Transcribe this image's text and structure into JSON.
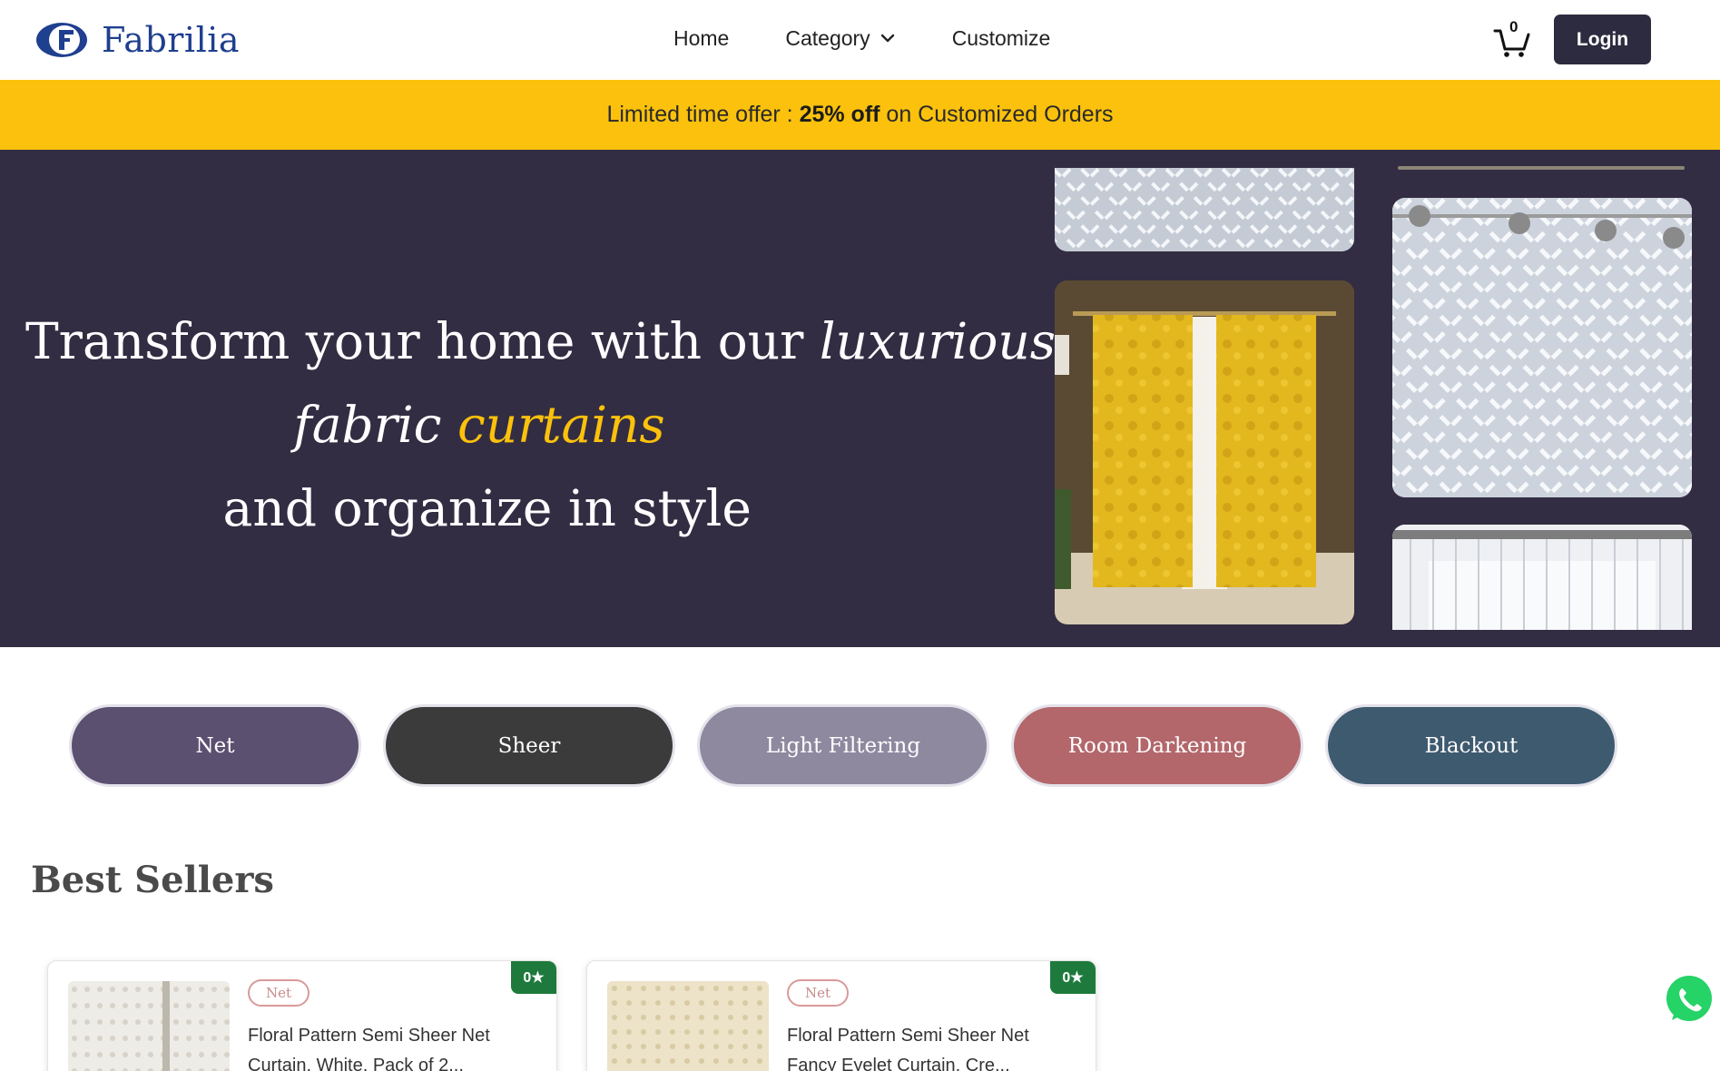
{
  "brand": {
    "name": "Fabrilia"
  },
  "nav": {
    "home": "Home",
    "category": "Category",
    "customize": "Customize",
    "cart_count": "0",
    "login": "Login"
  },
  "offer": {
    "prefix": "Limited time offer : ",
    "highlight": "25% off",
    "suffix": " on Customized Orders"
  },
  "hero": {
    "line1_plain": "Transform your home with our ",
    "line1_italic": "luxurious",
    "line2_italic": "fabric",
    "line2_accent": "curtains",
    "line2_plain": " and organize in style"
  },
  "categories": [
    {
      "label": "Net",
      "color": "#5b5070"
    },
    {
      "label": "Sheer",
      "color": "#3b3b3b"
    },
    {
      "label": "Light Filtering",
      "color": "#8e899f"
    },
    {
      "label": "Room Darkening",
      "color": "#b3676b"
    },
    {
      "label": "Blackout",
      "color": "#3e5a6f"
    }
  ],
  "best_sellers": {
    "title": "Best Sellers",
    "items": [
      {
        "tag": "Net",
        "title": "Floral Pattern Semi Sheer Net Curtain, White, Pack of 2...",
        "rating": "0★"
      },
      {
        "tag": "Net",
        "title": "Floral Pattern Semi Sheer Net Fancy Eyelet Curtain, Cre...",
        "rating": "0★"
      }
    ]
  },
  "colors": {
    "accent_yellow": "#fbc10c",
    "hero_bg": "#332d43",
    "brand_blue": "#1f3f8f",
    "login_bg": "#2d2b3f",
    "rating_green": "#1e7a3c",
    "whatsapp_green": "#25d366"
  },
  "icons": [
    "brand-logo-icon",
    "chevron-down-icon",
    "cart-icon",
    "whatsapp-icon"
  ]
}
